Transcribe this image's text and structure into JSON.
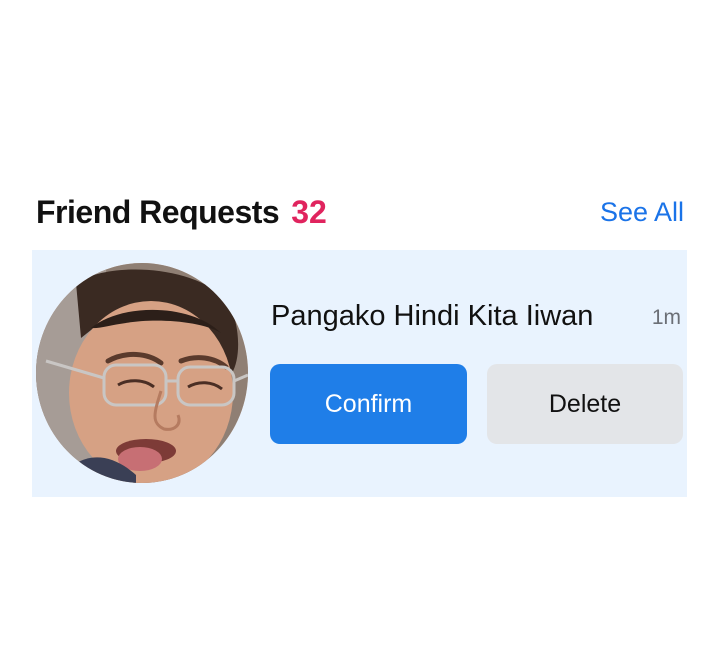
{
  "header": {
    "title": "Friend Requests",
    "count": "32",
    "see_all_label": "See All"
  },
  "request": {
    "name": "Pangako Hindi Kita Iiwan",
    "time": "1m",
    "confirm_label": "Confirm",
    "delete_label": "Delete"
  },
  "colors": {
    "count": "#e0245e",
    "link": "#1a73e8",
    "confirm_bg": "#1f7ee8",
    "delete_bg": "#e3e5e8",
    "card_bg": "#e9f3fe"
  }
}
